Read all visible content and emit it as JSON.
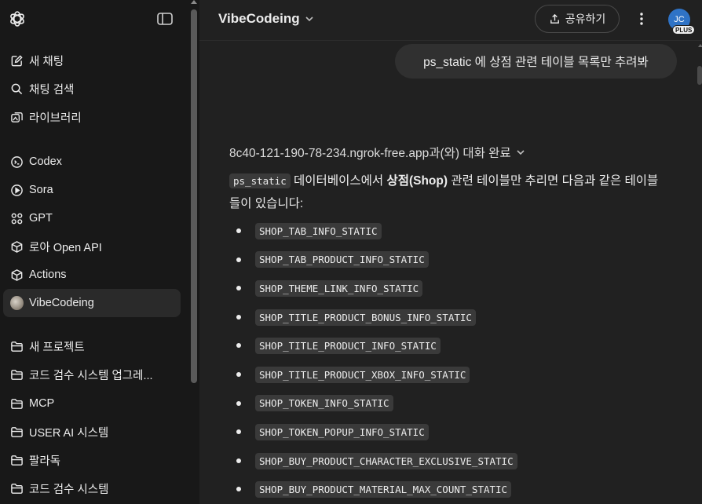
{
  "sidebar": {
    "logo_icon": "openai-logo-icon",
    "toggle_icon": "sidebar-toggle-icon",
    "items": [
      {
        "label": "새 채팅",
        "icon": "new-chat-icon"
      },
      {
        "label": "채팅 검색",
        "icon": "search-icon"
      },
      {
        "label": "라이브러리",
        "icon": "library-icon"
      },
      {
        "label": "Codex",
        "icon": "codex-icon"
      },
      {
        "label": "Sora",
        "icon": "sora-icon"
      },
      {
        "label": "GPT",
        "icon": "gpt-grid-icon"
      },
      {
        "label": "로아 Open API",
        "icon": "cube-icon"
      },
      {
        "label": "Actions",
        "icon": "cube-icon"
      },
      {
        "label": "VibeCodeing",
        "icon": "gpt-avatar-icon"
      },
      {
        "label": "새 프로젝트",
        "icon": "new-folder-icon"
      },
      {
        "label": "코드 검수 시스템 업그레...",
        "icon": "folder-icon"
      },
      {
        "label": "MCP",
        "icon": "folder-icon"
      },
      {
        "label": "USER AI 시스템",
        "icon": "folder-icon"
      },
      {
        "label": "팔라독",
        "icon": "folder-icon"
      },
      {
        "label": "코드 검수 시스템",
        "icon": "folder-icon"
      }
    ]
  },
  "header": {
    "title": "VibeCodeing",
    "share_label": "공유하기",
    "avatar_initials": "JC",
    "plan_badge": "PLUS"
  },
  "conversation": {
    "user_message": "ps_static 에 상점 관련 테이블 목록만 추려봐",
    "tool_status": "8c40-121-190-78-234.ngrok-free.app과(와) 대화 완료",
    "answer": {
      "code": "ps_static",
      "text_1": " 데이터베이스에서 ",
      "bold": "상점(Shop)",
      "text_2": " 관련 테이블만 추리면 다음과 같은 테이블들이 있습니다:"
    },
    "tables": [
      "SHOP_TAB_INFO_STATIC",
      "SHOP_TAB_PRODUCT_INFO_STATIC",
      "SHOP_THEME_LINK_INFO_STATIC",
      "SHOP_TITLE_PRODUCT_BONUS_INFO_STATIC",
      "SHOP_TITLE_PRODUCT_INFO_STATIC",
      "SHOP_TITLE_PRODUCT_XBOX_INFO_STATIC",
      "SHOP_TOKEN_INFO_STATIC",
      "SHOP_TOKEN_POPUP_INFO_STATIC",
      "SHOP_BUY_PRODUCT_CHARACTER_EXCLUSIVE_STATIC",
      "SHOP_BUY_PRODUCT_MATERIAL_MAX_COUNT_STATIC"
    ]
  },
  "colors": {
    "sidebar_bg": "#181818",
    "main_bg": "#212121",
    "user_bubble": "#303030",
    "avatar": "#2f73c6"
  }
}
